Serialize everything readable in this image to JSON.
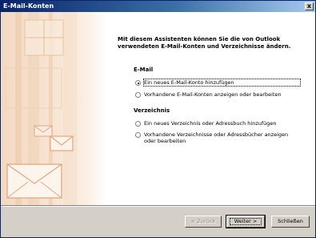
{
  "window": {
    "title": "E-Mail-Konten",
    "close_glyph": "x"
  },
  "intro_text": "Mit diesem Assistenten können Sie die von Outlook verwendeten E-Mail-Konten und Verzeichnisse ändern.",
  "email_group": {
    "title": "E-Mail",
    "options": [
      {
        "label": "Ein neues E-Mail-Konto hinzufügen",
        "checked": true
      },
      {
        "label": "Vorhandene E-Mail-Konten anzeigen oder bearbeiten",
        "checked": false
      }
    ]
  },
  "directory_group": {
    "title": "Verzeichnis",
    "options": [
      {
        "label": "Ein neues Verzeichnis oder Adressbuch hinzufügen",
        "checked": false
      },
      {
        "label": "Vorhandene Verzeichnisse oder Adressbücher anzeigen oder bearbeiten",
        "checked": false
      }
    ]
  },
  "buttons": {
    "back": "< Zurück",
    "next": "Weiter >",
    "close": "Schließen"
  },
  "colors": {
    "title_bar_start": "#0a246a",
    "title_bar_end": "#a6caf0",
    "dialog_face": "#d4d0c8",
    "art_panel": "#f3d9c2"
  },
  "icons": {
    "close": "close-icon",
    "art": "envelope-illustration"
  }
}
